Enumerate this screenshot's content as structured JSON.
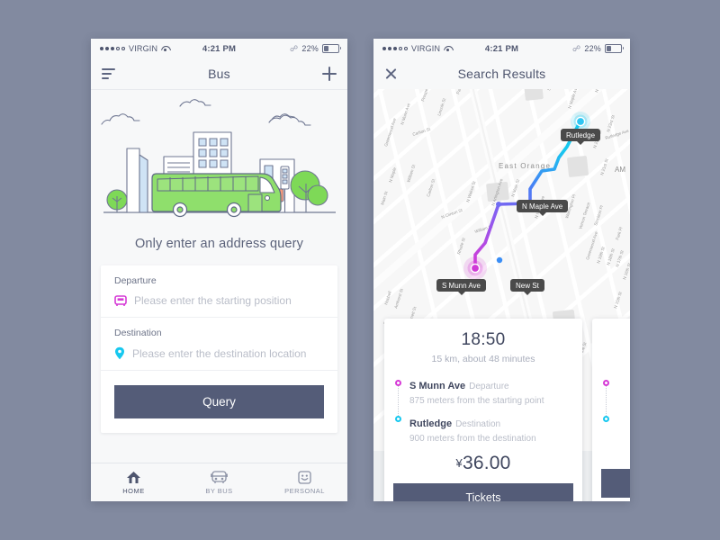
{
  "background_color": "#828aa0",
  "theme": {
    "primary_button": "#545c78",
    "text_dark": "#4e556e",
    "text_muted": "#b9bdc8",
    "magenta": "#d63ad6",
    "cyan": "#17c8ef",
    "green": "#7ed957"
  },
  "status_bar": {
    "signal_dots_filled": 3,
    "signal_dots_empty": 2,
    "carrier": "VIRGIN",
    "wifi_icon": "wifi-icon",
    "time": "4:21 PM",
    "bluetooth_icon": "bluetooth-icon",
    "battery_percent": "22%"
  },
  "left_phone": {
    "navbar": {
      "menu_icon": "hamburger-icon",
      "title": "Bus",
      "add_icon": "plus-icon"
    },
    "illustration": {
      "name": "city-bus-illustration"
    },
    "hero_text": "Only enter an address query",
    "form": {
      "departure": {
        "label": "Departure",
        "icon": "bus-stop-icon",
        "placeholder": "Please enter the starting position",
        "value": ""
      },
      "destination": {
        "label": "Destination",
        "icon": "map-pin-icon",
        "placeholder": "Please enter the destination location",
        "value": ""
      },
      "submit_label": "Query"
    },
    "tabbar": [
      {
        "icon": "home-icon",
        "label": "HOME",
        "active": true
      },
      {
        "icon": "bus-icon",
        "label": "BY BUS",
        "active": false
      },
      {
        "icon": "smiley-face-icon",
        "label": "PERSONAL",
        "active": false
      }
    ]
  },
  "right_phone": {
    "navbar": {
      "close_icon": "close-icon",
      "title": "Search Results"
    },
    "map": {
      "city_label": "East Orange",
      "markers": [
        {
          "label": "Rutledge",
          "type": "destination"
        },
        {
          "label": "N Maple Ave",
          "type": "waypoint"
        },
        {
          "label": "New St",
          "type": "waypoint"
        },
        {
          "label": "S Munn Ave",
          "type": "departure"
        }
      ],
      "streets": [
        "Greenwood Ave",
        "N Munn Ave",
        "Prospect St",
        "Lincoln St",
        "Park Ave",
        "Hamilton St",
        "N Maple Ave",
        "Springdale Ave",
        "Carlton St",
        "William St",
        "N Clinton St",
        "N Walnut St",
        "N Arlington Ave",
        "N Main St",
        "Main St",
        "Rutledge Ave",
        "N 22nd St",
        "N 21st St",
        "N 19th St",
        "N 18th St",
        "N 17th St",
        "N 16th St",
        "N 15th St",
        "Vernon Terrace",
        "Stockton Pl",
        "Warrington Pl",
        "Grove Pl",
        "Eaton Pl",
        "Beech Ave",
        "S Burnett St",
        "Lenox Ave",
        "S Munn Ave",
        "Amherst St",
        "Halsted St",
        "New St",
        "Mechanic St"
      ]
    },
    "result_card": {
      "time": "18:50",
      "summary": "15 km, about 48 minutes",
      "stops": [
        {
          "name": "S Munn Ave",
          "kind": "Departure",
          "distance": "875 meters from the starting point",
          "dot": "magenta"
        },
        {
          "name": "Rutledge",
          "kind": "Destination",
          "distance": "900 meters from the destination",
          "dot": "cyan"
        }
      ],
      "currency_symbol": "¥",
      "price": "36.00",
      "action_label": "Tickets"
    }
  }
}
